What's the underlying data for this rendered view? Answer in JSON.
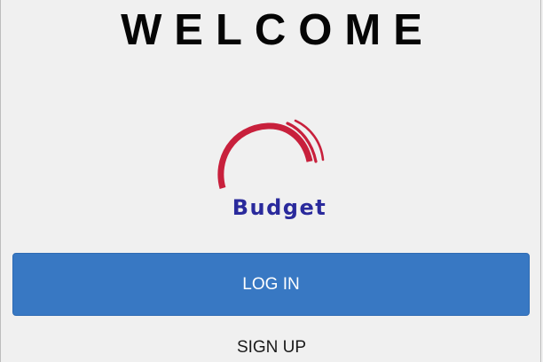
{
  "welcome": {
    "title": "WELCOME"
  },
  "logo": {
    "icon": "budget-arc-logo",
    "text": "Budget",
    "colors": {
      "arc": "#c8203c",
      "text": "#2a2a9c"
    }
  },
  "actions": {
    "login_label": "LOG IN",
    "signup_label": "SIGN UP"
  },
  "colors": {
    "background": "#f0f0f0",
    "primary": "#3878c3"
  }
}
